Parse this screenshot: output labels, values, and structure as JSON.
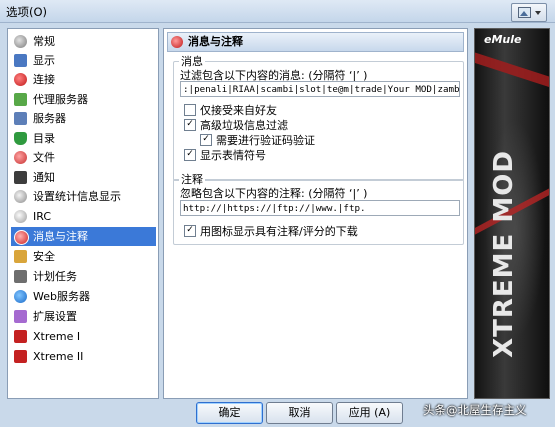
{
  "window": {
    "title": "选项(O)"
  },
  "sidebar": {
    "items": [
      {
        "label": "常规"
      },
      {
        "label": "显示"
      },
      {
        "label": "连接"
      },
      {
        "label": "代理服务器"
      },
      {
        "label": "服务器"
      },
      {
        "label": "目录"
      },
      {
        "label": "文件"
      },
      {
        "label": "通知"
      },
      {
        "label": "设置统计信息显示"
      },
      {
        "label": "IRC"
      },
      {
        "label": "消息与注释"
      },
      {
        "label": "安全"
      },
      {
        "label": "计划任务"
      },
      {
        "label": "Web服务器"
      },
      {
        "label": "扩展设置"
      },
      {
        "label": "Xtreme I"
      },
      {
        "label": "Xtreme II"
      }
    ],
    "selected": "消息与注释"
  },
  "page": {
    "header": "消息与注释",
    "messages_group": {
      "title": "消息",
      "filter_label": "过滤包含以下内容的消息: (分隔符 ‘|’ )",
      "filter_value": ":|penali|RIAA|scambi|slot|te@m|trade|Your MOD|zambor",
      "cb_friends_only": {
        "label": "仅接受来自好友",
        "checked": false
      },
      "cb_spam_filter": {
        "label": "高级垃圾信息过滤",
        "checked": true
      },
      "cb_captcha": {
        "label": "需要进行验证码验证",
        "checked": true
      },
      "cb_emoticons": {
        "label": "显示表情符号",
        "checked": true
      }
    },
    "comments_group": {
      "title": "注释",
      "ignore_label": "忽略包含以下内容的注释: (分隔符 ‘|’ )",
      "ignore_value": "http://|https://|ftp://|www.|ftp.",
      "cb_icon_rated": {
        "label": "用图标显示具有注释/评分的下载",
        "checked": true
      }
    }
  },
  "buttons": {
    "ok": "确定",
    "cancel": "取消",
    "apply": "应用 (A)"
  },
  "skin": {
    "logo": "eMule",
    "vertical_text": "XTREME MOD"
  },
  "watermark": "头条@北屋生存主义"
}
